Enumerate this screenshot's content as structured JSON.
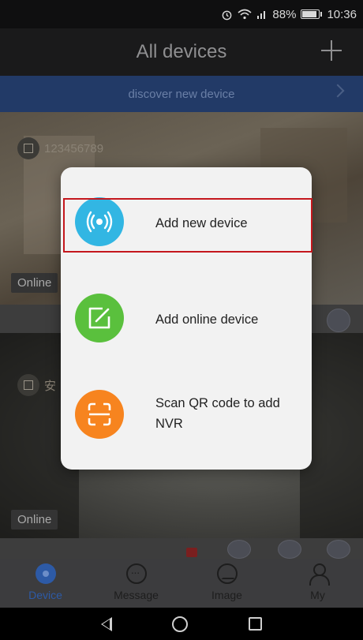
{
  "status_bar": {
    "icons": [
      "alarm-icon",
      "wifi-icon",
      "signal-icon",
      "battery-icon"
    ],
    "battery": "88%",
    "time": "10:36"
  },
  "header": {
    "title": "All devices",
    "add_icon": "plus-icon"
  },
  "discover": {
    "label": "discover new device",
    "icon": "chevron-right-icon"
  },
  "devices": [
    {
      "name": "123456789",
      "status": "Online"
    },
    {
      "name": "安",
      "status": "Online"
    }
  ],
  "popup": {
    "items": [
      {
        "label": "Add new device",
        "icon": "broadcast-icon",
        "color": "#32b6e3"
      },
      {
        "label": "Add online device",
        "icon": "edit-icon",
        "color": "#5ac03d"
      },
      {
        "label": "Scan QR code to add NVR",
        "icon": "scan-icon",
        "color": "#f7841f"
      }
    ]
  },
  "bottom_nav": {
    "items": [
      {
        "label": "Device",
        "icon": "device-icon",
        "active": true
      },
      {
        "label": "Message",
        "icon": "message-icon",
        "active": false
      },
      {
        "label": "Image",
        "icon": "image-icon",
        "active": false
      },
      {
        "label": "My",
        "icon": "person-icon",
        "active": false
      }
    ]
  },
  "system_nav": {
    "icons": [
      "back-icon",
      "home-icon",
      "recents-icon"
    ]
  },
  "colors": {
    "accent": "#2d5aa6",
    "highlight": "#c4171d"
  }
}
